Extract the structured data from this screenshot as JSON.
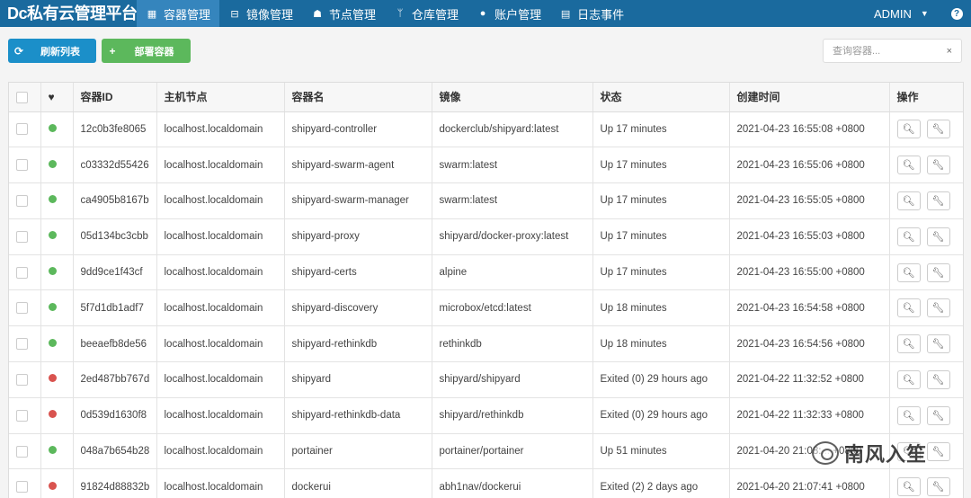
{
  "brand": "Dc私有云管理平台",
  "nav": [
    {
      "label": "容器管理",
      "icon": "grid-icon",
      "glyph": "▦",
      "active": true
    },
    {
      "label": "镜像管理",
      "icon": "hdd-icon",
      "glyph": "⊟",
      "active": false
    },
    {
      "label": "节点管理",
      "icon": "sitemap-icon",
      "glyph": "☗",
      "active": false
    },
    {
      "label": "仓库管理",
      "icon": "branch-icon",
      "glyph": "ᛘ",
      "active": false
    },
    {
      "label": "账户管理",
      "icon": "user-icon",
      "glyph": "●",
      "active": false
    },
    {
      "label": "日志事件",
      "icon": "list-icon",
      "glyph": "▤",
      "active": false
    }
  ],
  "user": {
    "label": "ADMIN"
  },
  "help": "?",
  "toolbar": {
    "refresh_label": "刷新列表",
    "deploy_label": "部署容器",
    "search_placeholder": "查询容器...",
    "clear": "×",
    "colors": {
      "refresh": "#1b8fc9",
      "deploy": "#5cb85c"
    }
  },
  "table": {
    "headers": [
      "",
      "",
      "容器ID",
      "主机节点",
      "容器名",
      "镜像",
      "状态",
      "创建时间",
      "操作"
    ],
    "status_colors": {
      "running": "#5cb85c",
      "stopped": "#d9534f"
    },
    "rows": [
      {
        "state": "running",
        "id": "12c0b3fe8065",
        "node": "localhost.localdomain",
        "name": "shipyard-controller",
        "image": "dockerclub/shipyard:latest",
        "status": "Up 17 minutes",
        "created": "2021-04-23 16:55:08 +0800"
      },
      {
        "state": "running",
        "id": "c03332d55426",
        "node": "localhost.localdomain",
        "name": "shipyard-swarm-agent",
        "image": "swarm:latest",
        "status": "Up 17 minutes",
        "created": "2021-04-23 16:55:06 +0800"
      },
      {
        "state": "running",
        "id": "ca4905b8167b",
        "node": "localhost.localdomain",
        "name": "shipyard-swarm-manager",
        "image": "swarm:latest",
        "status": "Up 17 minutes",
        "created": "2021-04-23 16:55:05 +0800"
      },
      {
        "state": "running",
        "id": "05d134bc3cbb",
        "node": "localhost.localdomain",
        "name": "shipyard-proxy",
        "image": "shipyard/docker-proxy:latest",
        "status": "Up 17 minutes",
        "created": "2021-04-23 16:55:03 +0800"
      },
      {
        "state": "running",
        "id": "9dd9ce1f43cf",
        "node": "localhost.localdomain",
        "name": "shipyard-certs",
        "image": "alpine",
        "status": "Up 17 minutes",
        "created": "2021-04-23 16:55:00 +0800"
      },
      {
        "state": "running",
        "id": "5f7d1db1adf7",
        "node": "localhost.localdomain",
        "name": "shipyard-discovery",
        "image": "microbox/etcd:latest",
        "status": "Up 18 minutes",
        "created": "2021-04-23 16:54:58 +0800"
      },
      {
        "state": "running",
        "id": "beeaefb8de56",
        "node": "localhost.localdomain",
        "name": "shipyard-rethinkdb",
        "image": "rethinkdb",
        "status": "Up 18 minutes",
        "created": "2021-04-23 16:54:56 +0800"
      },
      {
        "state": "stopped",
        "id": "2ed487bb767d",
        "node": "localhost.localdomain",
        "name": "shipyard",
        "image": "shipyard/shipyard",
        "status": "Exited (0) 29 hours ago",
        "created": "2021-04-22 11:32:52 +0800"
      },
      {
        "state": "stopped",
        "id": "0d539d1630f8",
        "node": "localhost.localdomain",
        "name": "shipyard-rethinkdb-data",
        "image": "shipyard/rethinkdb",
        "status": "Exited (0) 29 hours ago",
        "created": "2021-04-22 11:32:33 +0800"
      },
      {
        "state": "running",
        "id": "048a7b654b28",
        "node": "localhost.localdomain",
        "name": "portainer",
        "image": "portainer/portainer",
        "status": "Up 51 minutes",
        "created": "2021-04-20 21:08:... +0800"
      },
      {
        "state": "stopped",
        "id": "91824d88832b",
        "node": "localhost.localdomain",
        "name": "dockerui",
        "image": "abh1nav/dockerui",
        "status": "Exited (2) 2 days ago",
        "created": "2021-04-20 21:07:41 +0800"
      }
    ]
  },
  "watermark": "南风入笙"
}
